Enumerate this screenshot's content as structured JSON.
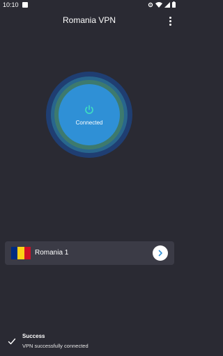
{
  "status_bar": {
    "time": "10:10"
  },
  "app_bar": {
    "title": "Romania VPN"
  },
  "power": {
    "status_label": "Connected"
  },
  "server": {
    "name": "Romania 1",
    "flag_colors": [
      "#002B7F",
      "#FCD116",
      "#CE1126"
    ]
  },
  "snackbar": {
    "title": "Success",
    "message": "VPN successfully connected"
  },
  "colors": {
    "background": "#2a2a33",
    "power_button": "#2f90d6",
    "ring_outer": "#1f3e72",
    "ring_middle": "#28668d",
    "ring_inner": "#3d7a6e",
    "card": "#3b3b46",
    "chevron": "#2f90d6"
  },
  "icons": {
    "status_app": "app-notification-icon",
    "wifi": "wifi-icon",
    "signal": "signal-icon",
    "battery": "battery-icon",
    "menu": "more-vert-icon",
    "power": "power-icon",
    "chevron": "chevron-right-icon",
    "check": "check-icon"
  }
}
